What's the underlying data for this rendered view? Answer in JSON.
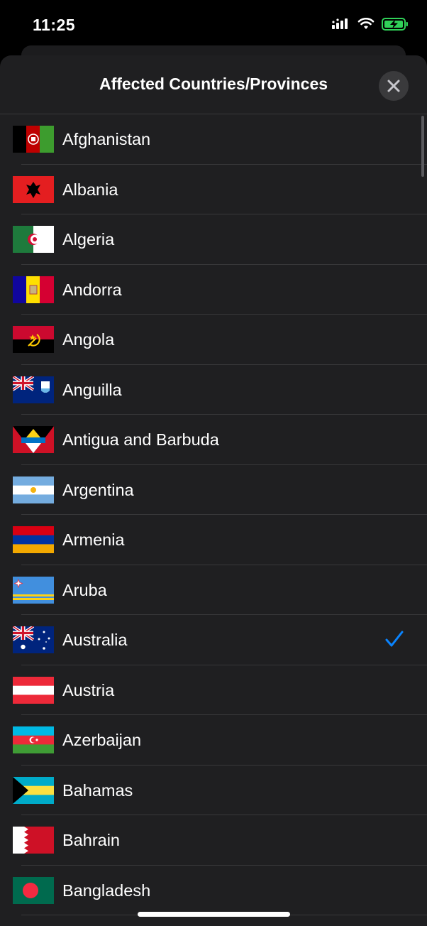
{
  "status_bar": {
    "time": "11:25",
    "signal_icon": "cellular-signal-icon",
    "wifi_icon": "wifi-icon",
    "battery_icon": "battery-charging-icon",
    "battery_color": "#30d158"
  },
  "sheet": {
    "title": "Affected Countries/Provinces",
    "close_icon": "close-icon",
    "accent_color": "#0a84ff"
  },
  "countries": [
    {
      "name": "Afghanistan",
      "flag_icon": "afghanistan-flag-icon",
      "selected": false
    },
    {
      "name": "Albania",
      "flag_icon": "albania-flag-icon",
      "selected": false
    },
    {
      "name": "Algeria",
      "flag_icon": "algeria-flag-icon",
      "selected": false
    },
    {
      "name": "Andorra",
      "flag_icon": "andorra-flag-icon",
      "selected": false
    },
    {
      "name": "Angola",
      "flag_icon": "angola-flag-icon",
      "selected": false
    },
    {
      "name": "Anguilla",
      "flag_icon": "anguilla-flag-icon",
      "selected": false
    },
    {
      "name": "Antigua and Barbuda",
      "flag_icon": "antigua-and-barbuda-flag-icon",
      "selected": false
    },
    {
      "name": "Argentina",
      "flag_icon": "argentina-flag-icon",
      "selected": false
    },
    {
      "name": "Armenia",
      "flag_icon": "armenia-flag-icon",
      "selected": false
    },
    {
      "name": "Aruba",
      "flag_icon": "aruba-flag-icon",
      "selected": false
    },
    {
      "name": "Australia",
      "flag_icon": "australia-flag-icon",
      "selected": true
    },
    {
      "name": "Austria",
      "flag_icon": "austria-flag-icon",
      "selected": false
    },
    {
      "name": "Azerbaijan",
      "flag_icon": "azerbaijan-flag-icon",
      "selected": false
    },
    {
      "name": "Bahamas",
      "flag_icon": "bahamas-flag-icon",
      "selected": false
    },
    {
      "name": "Bahrain",
      "flag_icon": "bahrain-flag-icon",
      "selected": false
    },
    {
      "name": "Bangladesh",
      "flag_icon": "bangladesh-flag-icon",
      "selected": false
    }
  ]
}
